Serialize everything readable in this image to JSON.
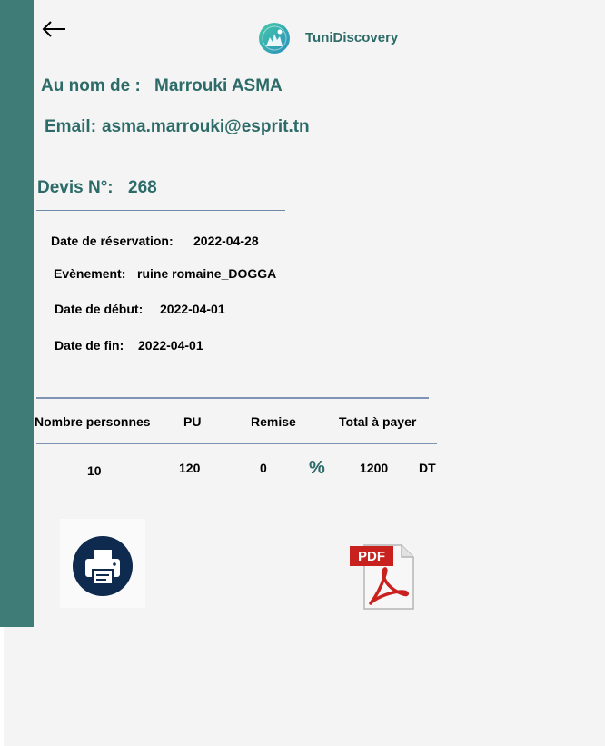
{
  "header": {
    "app_title": "TuniDiscovery",
    "back_icon": "arrow-left-icon",
    "logo_icon": "tunidiscovery-logo"
  },
  "client": {
    "name_label": "Au nom de :",
    "name_value": "Marrouki ASMA",
    "email_label": "Email:",
    "email_value": "asma.marrouki@esprit.tn"
  },
  "devis": {
    "label": "Devis N°:",
    "number": "268"
  },
  "details": {
    "reservation_date_label": "Date de réservation:",
    "reservation_date_value": "2022-04-28",
    "event_label": "Evènement:",
    "event_value": "ruine romaine_DOGGA",
    "start_date_label": "Date de début:",
    "start_date_value": "2022-04-01",
    "end_date_label": "Date de fin:",
    "end_date_value": "2022-04-01"
  },
  "table": {
    "headers": [
      "Nombre personnes",
      "PU",
      "Remise",
      "Total à payer"
    ],
    "row": {
      "persons": "10",
      "unit_price": "120",
      "discount": "0",
      "discount_unit": "%",
      "total": "1200",
      "currency": "DT"
    }
  },
  "actions": {
    "print_icon": "printer-icon",
    "pdf_icon": "pdf-icon",
    "pdf_text": "PDF"
  },
  "colors": {
    "sidebar": "#3f7b77",
    "accent_text": "#2c6b68",
    "divider": "#7f93b5",
    "print_button": "#0f2a4f",
    "pdf_red": "#c8211e"
  }
}
